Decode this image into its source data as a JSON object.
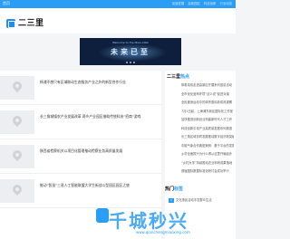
{
  "topbar": {
    "home": "首页",
    "links": [
      "加速发展",
      "高新园区",
      "科技创新",
      "行业动态"
    ]
  },
  "header": {
    "logo_text": "二三里"
  },
  "banner": {
    "subtitle": "Welcome to the Mars AIGC",
    "title": "未来已至"
  },
  "articles": [
    {
      "title": "杨浦不想只有区域联动生态服务产业之外的新型合作行业"
    },
    {
      "title": "长三角城镇农产业发展改革 两乡产业园区借助传统科技“招商”游戏"
    },
    {
      "title": "陕西省检察机关以项目化管理推动检察业务高质量发展"
    },
    {
      "title": "推动“智慧”三晋人工智能联盟大学生街战斗型园区园区之旅"
    }
  ],
  "sidebar": {
    "head_prefix": "二三里",
    "head_accent": "热点",
    "items": [
      "带着真情走进高新区开展系列宣讲活动",
      "全市优化营商环境“这么说”促进对接",
      "全民健身运动中的体育惠民新成效观察",
      "7月1日起，上海浦东新区国际化工作室",
      "加快推进创新创业构建新时代人才工作",
      "科技创新引领产业高质量发展系列报道",
      "长三角区域协同发展推动数字经济新突破",
      "中欧气象合作典型案例：基于平台的发展",
      "乡村全面振兴为什么得从这里开局起步",
      "“乡村大学”持续推动农业科研成果落地",
      "首届国际数据标准化研讨会成功举行"
    ]
  },
  "hot": {
    "head_prefix": "热门",
    "head_accent": "标签",
    "items": [
      {
        "num": "1",
        "text": "文化惠民活动丰富群众生活"
      }
    ]
  },
  "watermark": {
    "text": "千城秒兴",
    "url": "www.qianchengmiaoxing.com"
  },
  "colors": {
    "accent": "#2a9df4",
    "banner_bg": "#0d1f3c",
    "page_bg": "#f4f5f7"
  }
}
